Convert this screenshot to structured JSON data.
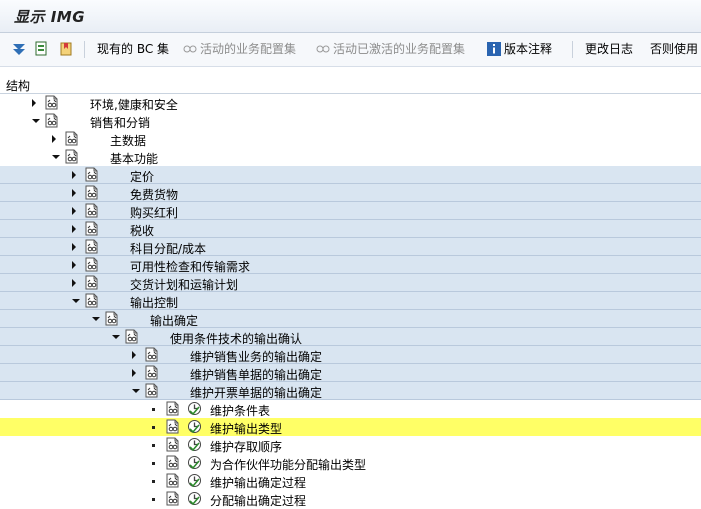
{
  "title": "显示 IMG",
  "toolbar": {
    "bc_sets": "现有的 BC 集",
    "active_bc_sets": "活动的业务配置集",
    "activated_bc_sets": "活动已激活的业务配置集",
    "release_notes": "版本注释",
    "change_log": "更改日志",
    "cut_usage": "否则使用"
  },
  "tree_header": "结构",
  "tree": [
    {
      "label": "环境,健康和安全"
    },
    {
      "label": "销售和分销"
    },
    {
      "label": "主数据"
    },
    {
      "label": "基本功能"
    },
    {
      "label": "定价"
    },
    {
      "label": "免费货物"
    },
    {
      "label": "购买红利"
    },
    {
      "label": "税收"
    },
    {
      "label": "科目分配/成本"
    },
    {
      "label": "可用性检查和传输需求"
    },
    {
      "label": "交货计划和运输计划"
    },
    {
      "label": "输出控制"
    },
    {
      "label": "输出确定"
    },
    {
      "label": "使用条件技术的输出确认"
    },
    {
      "label": "维护销售业务的输出确定"
    },
    {
      "label": "维护销售单据的输出确定"
    },
    {
      "label": "维护开票单据的输出确定"
    },
    {
      "label": "维护条件表"
    },
    {
      "label": "维护输出类型"
    },
    {
      "label": "维护存取顺序"
    },
    {
      "label": "为合作伙伴功能分配输出类型"
    },
    {
      "label": "维护输出确定过程"
    },
    {
      "label": "分配输出确定过程"
    }
  ],
  "colors": {
    "highlight": "#ffff66",
    "shade": "#d9e5f1"
  }
}
